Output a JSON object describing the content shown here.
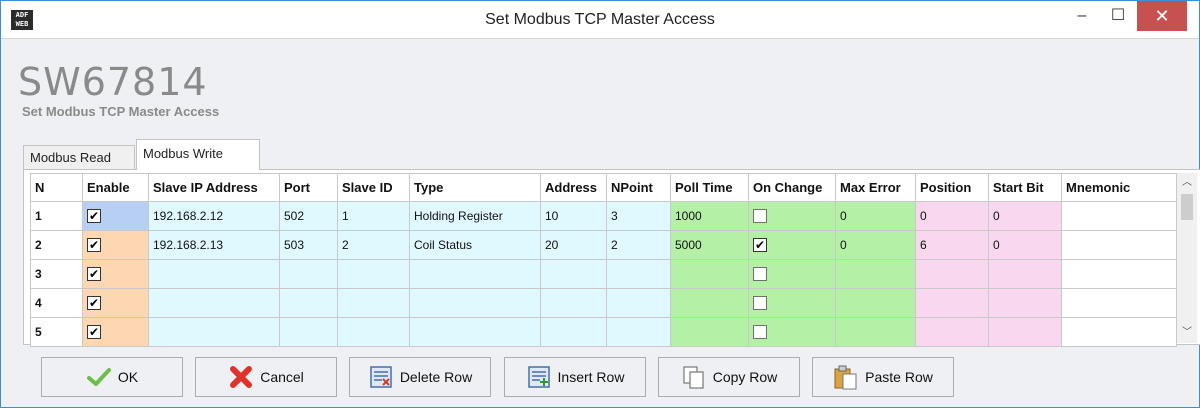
{
  "window": {
    "title": "Set Modbus TCP Master Access",
    "app_icon_text": "ADF WEB",
    "minimize": "–",
    "maximize": "☐",
    "close": "✕"
  },
  "header": {
    "code": "SW67814",
    "subtitle": "Set Modbus TCP Master Access"
  },
  "tabs": [
    {
      "label": "Modbus Read",
      "active": false
    },
    {
      "label": "Modbus Write",
      "active": true
    }
  ],
  "table": {
    "columns": [
      "N",
      "Enable",
      "Slave IP Address",
      "Port",
      "Slave ID",
      "Type",
      "Address",
      "NPoint",
      "Poll Time",
      "On Change",
      "Max Error",
      "Position",
      "Start Bit",
      "Mnemonic"
    ],
    "rows": [
      {
        "n": "1",
        "enable": true,
        "ip": "192.168.2.12",
        "port": "502",
        "slave_id": "1",
        "type": "Holding Register",
        "address": "10",
        "npoint": "3",
        "poll_time": "1000",
        "on_change": false,
        "max_error": "0",
        "position": "0",
        "start_bit": "0",
        "mnemonic": ""
      },
      {
        "n": "2",
        "enable": true,
        "ip": "192.168.2.13",
        "port": "503",
        "slave_id": "2",
        "type": "Coil Status",
        "address": "20",
        "npoint": "2",
        "poll_time": "5000",
        "on_change": true,
        "max_error": "0",
        "position": "6",
        "start_bit": "0",
        "mnemonic": ""
      },
      {
        "n": "3",
        "enable": true,
        "ip": "",
        "port": "",
        "slave_id": "",
        "type": "",
        "address": "",
        "npoint": "",
        "poll_time": "",
        "on_change": false,
        "max_error": "",
        "position": "",
        "start_bit": "",
        "mnemonic": ""
      },
      {
        "n": "4",
        "enable": true,
        "ip": "",
        "port": "",
        "slave_id": "",
        "type": "",
        "address": "",
        "npoint": "",
        "poll_time": "",
        "on_change": false,
        "max_error": "",
        "position": "",
        "start_bit": "",
        "mnemonic": ""
      },
      {
        "n": "5",
        "enable": true,
        "ip": "",
        "port": "",
        "slave_id": "",
        "type": "",
        "address": "",
        "npoint": "",
        "poll_time": "",
        "on_change": false,
        "max_error": "",
        "position": "",
        "start_bit": "",
        "mnemonic": ""
      }
    ]
  },
  "buttons": {
    "ok": "OK",
    "cancel": "Cancel",
    "delete_row": "Delete Row",
    "insert_row": "Insert Row",
    "copy_row": "Copy Row",
    "paste_row": "Paste Row"
  },
  "colors": {
    "enable_cell": "#fdd6b2",
    "enable_selected": "#b7cff3",
    "connection_cells": "#e0f8ff",
    "poll_cells": "#b5f0a7",
    "position_cells": "#f9d7ef",
    "close_button": "#c75050"
  }
}
